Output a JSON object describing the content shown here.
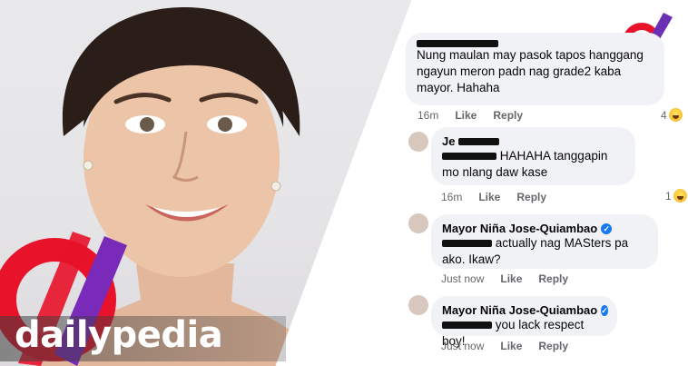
{
  "brand": {
    "name": "dailypedia"
  },
  "comments": [
    {
      "author": "",
      "text": "Nung maulan may pasok tapos hanggang ngayun meron padn nag grade2 kaba mayor. Hahaha",
      "time": "16m",
      "like": "Like",
      "reply": "Reply",
      "reactions": "4"
    },
    {
      "author": "Je",
      "mention": "",
      "text": "HAHAHA tanggapin mo nlang daw kase",
      "time": "16m",
      "like": "Like",
      "reply": "Reply",
      "reactions": "1"
    },
    {
      "author": "Mayor Niña Jose-Quiambao",
      "mention": "",
      "text": "actually nag MASters pa ako. Ikaw?",
      "time": "Just now",
      "like": "Like",
      "reply": "Reply"
    },
    {
      "author": "Mayor Niña Jose-Quiambao",
      "mention": "",
      "text": "you lack respect boy!",
      "time": "Just now",
      "like": "Like",
      "reply": "Reply"
    }
  ],
  "colors": {
    "brand_red": "#e8122a",
    "brand_purple": "#6b2fb3",
    "bubble": "#f0f2f5",
    "meta": "#65676b"
  },
  "icons": [
    "dailypedia-logo-icon",
    "laugh-reaction-icon",
    "verified-badge-icon"
  ]
}
